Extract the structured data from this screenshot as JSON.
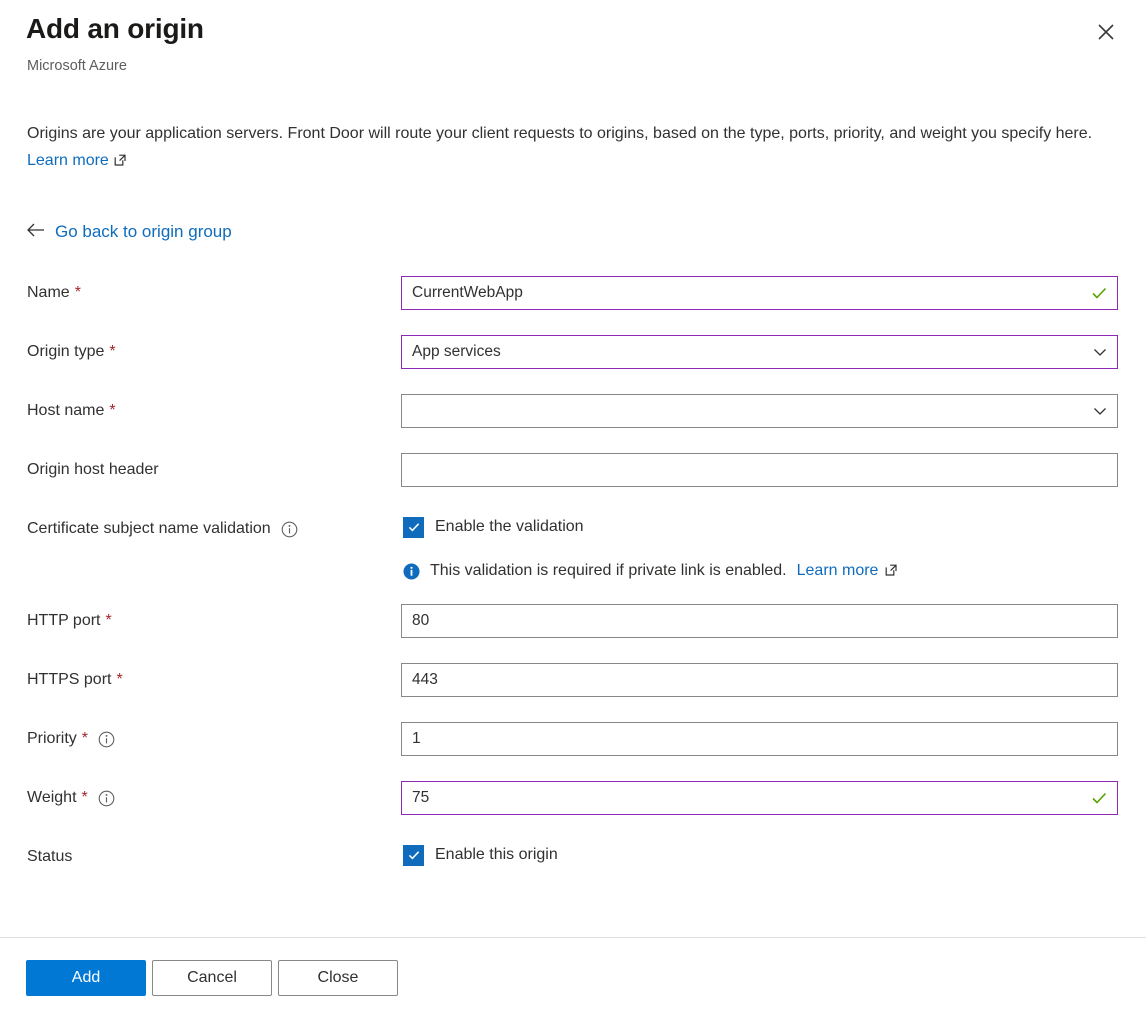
{
  "header": {
    "title": "Add an origin",
    "subtitle": "Microsoft Azure",
    "close_icon": "close-icon"
  },
  "description": {
    "text": "Origins are your application servers. Front Door will route your client requests to origins, based on the type, ports, priority, and weight you specify here.",
    "link_label": "Learn more",
    "link_icon": "external-link-icon"
  },
  "go_back": {
    "label": "Go back to origin group",
    "icon": "arrow-left-icon"
  },
  "form": {
    "name": {
      "label": "Name",
      "required_marker": "*",
      "value": "CurrentWebApp",
      "placeholder": "",
      "state_icon": "checkmark-icon",
      "dirty": true
    },
    "origin_type": {
      "label": "Origin type",
      "required_marker": "*",
      "value": "App services",
      "state_icon": "chevron-down-icon",
      "dirty": true
    },
    "host_name": {
      "label": "Host name",
      "required_marker": "*",
      "value": "",
      "state_icon": "chevron-down-icon",
      "dirty": false
    },
    "origin_host_header": {
      "label": "Origin host header",
      "required_marker": "",
      "value": "",
      "placeholder": "",
      "dirty": false
    },
    "cert_validation": {
      "label": "Certificate subject name validation",
      "info_icon": "info-circle-icon",
      "checkbox_label": "Enable the validation",
      "checked": true,
      "message_icon": "info-filled-icon",
      "message_text": "This validation is required if private link is enabled.",
      "message_link": "Learn more",
      "message_link_icon": "external-link-icon"
    },
    "http_port": {
      "label": "HTTP port",
      "required_marker": "*",
      "value": "80",
      "dirty": false
    },
    "https_port": {
      "label": "HTTPS port",
      "required_marker": "*",
      "value": "443",
      "dirty": false
    },
    "priority": {
      "label": "Priority",
      "required_marker": "*",
      "info_icon": "info-circle-icon",
      "value": "1",
      "dirty": false
    },
    "weight": {
      "label": "Weight",
      "required_marker": "*",
      "info_icon": "info-circle-icon",
      "value": "75",
      "state_icon": "checkmark-icon",
      "dirty": true
    },
    "status": {
      "label": "Status",
      "checkbox_label": "Enable this origin",
      "checked": true
    }
  },
  "footer": {
    "add_label": "Add",
    "cancel_label": "Cancel",
    "close_label": "Close"
  },
  "colors": {
    "accent": "#0078d4",
    "link": "#0f6cbd",
    "required": "#a4262c",
    "dirty_border": "#8d29b5",
    "valid_check": "#57a300",
    "border": "#8a8886",
    "text": "#323130",
    "muted_text": "#605e5c",
    "separator": "#e1dfdd"
  }
}
